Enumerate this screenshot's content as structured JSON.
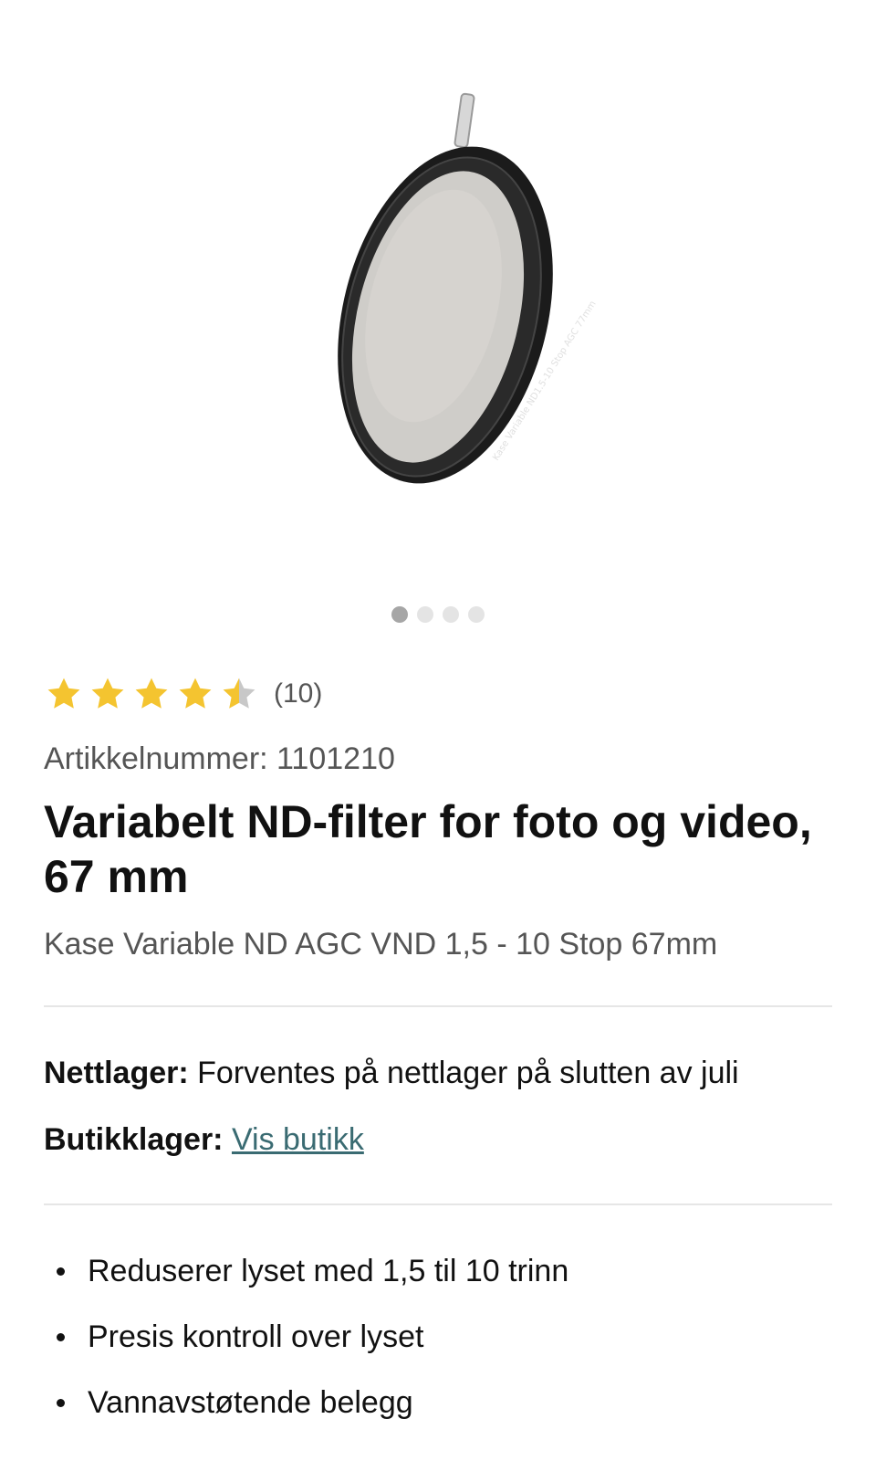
{
  "gallery": {
    "image_alt": "Kase Variable ND AGC VND 1,5 - 10 Stop 67mm",
    "slide_count": 4,
    "active_slide": 1,
    "ring_text": "Kase Variable ND1.5-10 Stop AGC 77mm"
  },
  "rating": {
    "value": 4.5,
    "max": 5,
    "count_text": "(10)",
    "star_color": "#f4c430",
    "empty_star_color": "#c8c8c8"
  },
  "product": {
    "sku": "Artikkelnummer: 1101210",
    "title": "Variabelt ND-filter for foto og video, 67 mm",
    "subtitle": "Kase Variable ND AGC VND 1,5 - 10 Stop 67mm"
  },
  "stock": {
    "online_label": "Nettlager:",
    "online_value": "Forventes på nettlager på slutten av juli",
    "store_label": "Butikklager:",
    "store_link": "Vis butikk",
    "link_color": "#3a6b72"
  },
  "features": [
    "Reduserer lyset med 1,5 til 10 trinn",
    "Presis kontroll over lyset",
    "Vannavstøtende belegg"
  ]
}
